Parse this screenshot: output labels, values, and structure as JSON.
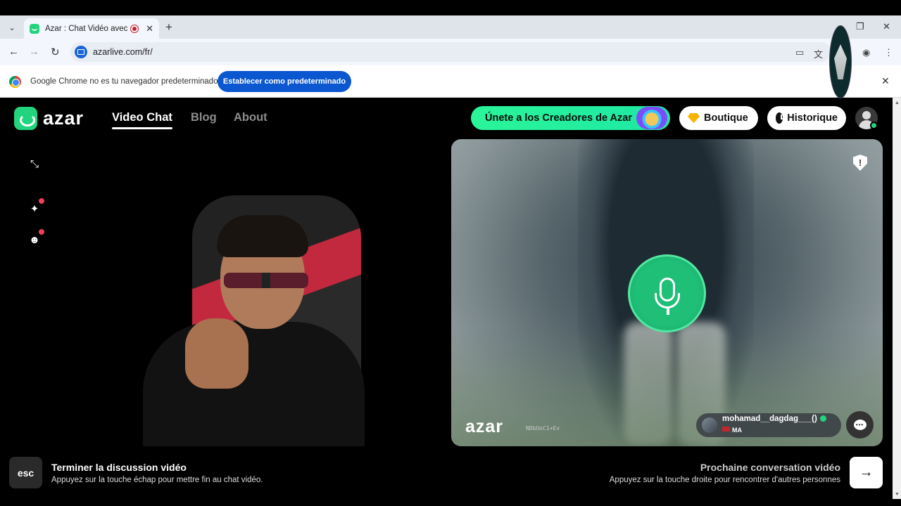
{
  "browser": {
    "tab_title": "Azar : Chat Vidéo avec de n",
    "tab_close": "✕",
    "new_tab": "+",
    "url": "azarlive.com/fr/",
    "infobar_text": "Google Chrome no es tu navegador predeterminado",
    "infobar_button": "Establecer como predeterminado",
    "infobar_close": "✕"
  },
  "header": {
    "logo_text": "azar",
    "nav": [
      {
        "label": "Video Chat",
        "active": true
      },
      {
        "label": "Blog",
        "active": false
      },
      {
        "label": "About",
        "active": false
      }
    ],
    "creators_label": "Únete a los Creadores de Azar",
    "boutique_label": "Boutique",
    "history_label": "Historique"
  },
  "remote_video": {
    "watermark_logo": "azar",
    "watermark_id": "NDbUoC1+Ev",
    "username": "mohamad__dagdag___()",
    "country": "MA",
    "report_icon": "!",
    "chat_icon": "•••"
  },
  "footer": {
    "esc_key": "esc",
    "end_title": "Terminer la discussion vidéo",
    "end_subtitle": "Appuyez sur la touche échap pour mettre fin au chat vidéo.",
    "next_title": "Prochaine conversation vidéo",
    "next_subtitle": "Appuyez sur la touche droite pour rencontrer d'autres personnes",
    "next_arrow": "→"
  },
  "colors": {
    "accent": "#21d47d",
    "chrome_blue": "#0b57d0",
    "notify_red": "#ef3f5a"
  }
}
